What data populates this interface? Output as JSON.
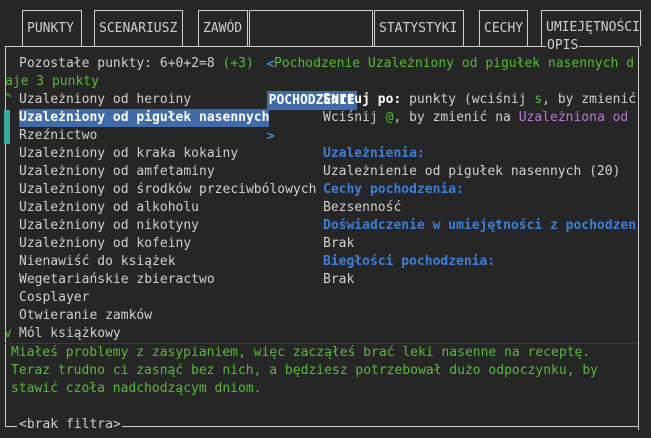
{
  "tabs": [
    {
      "label": "PUNKTY"
    },
    {
      "label": "SCENARIUSZ"
    },
    {
      "label": "ZAWÓD"
    },
    {
      "label": "POCHODZENIE",
      "left_arrow": "<",
      "right_arrow": ">"
    },
    {
      "label": "STATYSTYKI"
    },
    {
      "label": "CECHY"
    },
    {
      "label": "UMIEJĘTNOŚCI"
    }
  ],
  "header": {
    "points_label": "Pozostałe punkty: 6+0+2=8",
    "points_delta": "(+3)",
    "origin_text": "Pochodzenie Uzależniony od pigułek nasennych d",
    "origin_text_wrap": "aje 3 punkty",
    "opis_label": "OPIS"
  },
  "list": {
    "scroll_up": "^",
    "scroll_down": "v",
    "selected_index": 1,
    "items": [
      "Uzależniony od heroiny",
      "Uzależniony od pigułek nasennych",
      "Rzeźnictwo",
      "Uzależniony od kraka kokainy",
      "Uzależniony od amfetaminy",
      "Uzależniony od środków przeciwbólowych",
      "Uzależniony od alkoholu",
      "Uzależniony od nikotyny",
      "Uzależniony od kofeiny",
      "Nienawiść do książek",
      "Wegetariańskie zbieractwo",
      "Cosplayer",
      "Otwieranie zamków",
      "Mól książkowy"
    ]
  },
  "details": {
    "sort_label": "Sortuj po:",
    "sort_text_a": " punkty (wciśnij ",
    "sort_key": "s",
    "sort_text_b": ", by zmienić",
    "gender_text_a": "Wciśnij ",
    "gender_key": "@",
    "gender_text_b": ", by zmienić na ",
    "gender_alt": "Uzależniona od",
    "addictions_heading": "Uzależnienia:",
    "addiction_value": "Uzależnienie od pigułek nasennych (20)",
    "traits_heading": "Cechy pochodzenia:",
    "trait_value": "Bezsenność",
    "exp_heading": "Doświadczenie w umiejętności z pochodzen",
    "exp_value": "Brak",
    "prof_heading": "Biegłości pochodzenia:",
    "prof_value": "Brak"
  },
  "description": {
    "line1": "Miałeś problemy z zasypianiem, więc zacząłeś brać leki nasenne na receptę.",
    "line2": "Teraz trudno ci zasnąć bez nich, a będziesz potrzebował dużo odpoczynku, by",
    "line3": "stawić czoła nadchodzącym dniom."
  },
  "footer": {
    "filter_label": "<brak filtra>"
  },
  "colors": {
    "background": "#262626",
    "text": "#cfcfcf",
    "highlight": "#3f6ca8",
    "green": "#58b936",
    "heading_blue": "#3b7fd6",
    "purple": "#b27bd0"
  }
}
